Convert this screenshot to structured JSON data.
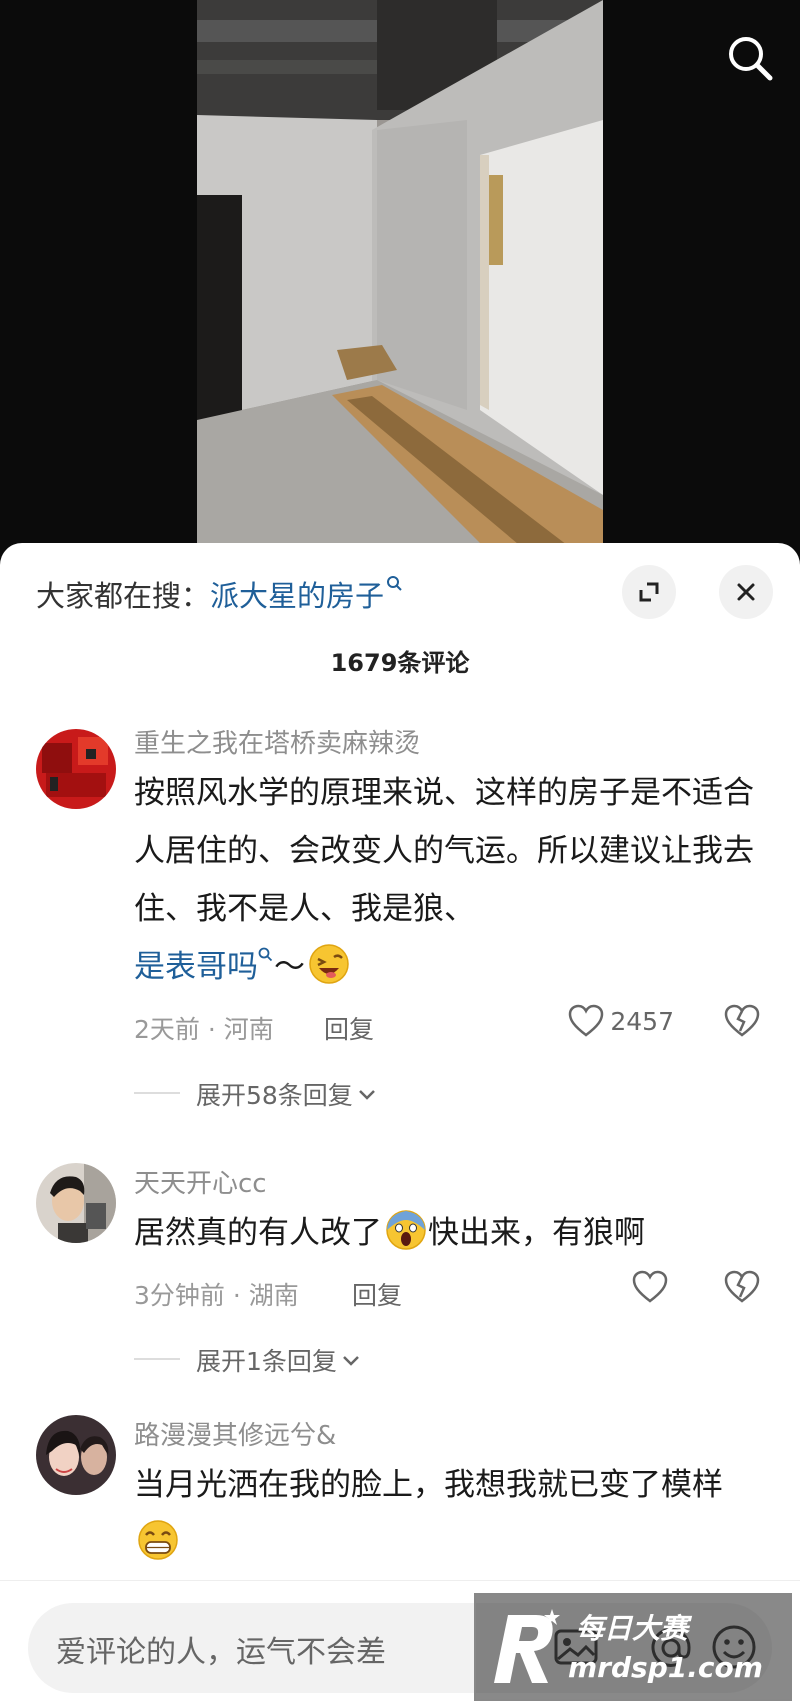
{
  "colors": {
    "accent": "#1f5f99",
    "text": "#1a1a1a",
    "muted": "#8e8e8e"
  },
  "trending": {
    "prefix": "大家都在搜：",
    "keyword": "派大星的房子"
  },
  "comment_count": "1679条评论",
  "comments": [
    {
      "username": "重生之我在塔桥卖麻辣烫",
      "text": "按照风水学的原理来说、这样的房子是不适合人居住的、会改变人的气运。所以建议让我去住、我不是人、我是狼、",
      "topic": "是表哥吗",
      "suffix": "～",
      "emoji": "grinning-squint-emoji",
      "time": "2天前 · 河南",
      "reply": "回复",
      "likes": "2457",
      "expand": "展开58条回复"
    },
    {
      "username": "天天开心cc",
      "text": "居然真的有人改了",
      "emoji": "scream-emoji",
      "text_after": "快出来，有狼啊",
      "time": "3分钟前 · 湖南",
      "reply": "回复",
      "likes": "",
      "expand": "展开1条回复"
    },
    {
      "username": "路漫漫其修远兮&",
      "text": "当月光洒在我的脸上，我想我就已变了模样",
      "emoji": "grin-emoji"
    }
  ],
  "input": {
    "placeholder": "爱评论的人，运气不会差"
  },
  "watermark": {
    "line1": "每日大赛",
    "line2": "mrdsp1.com"
  }
}
